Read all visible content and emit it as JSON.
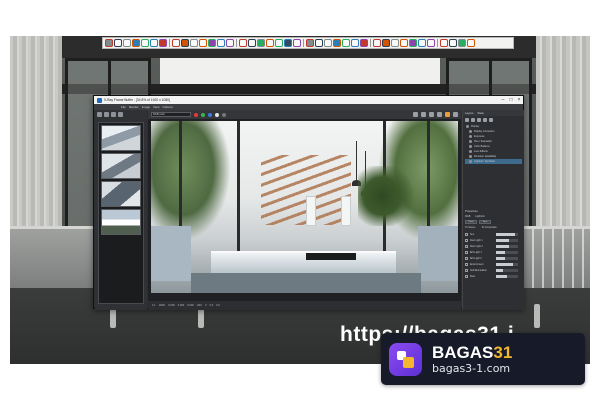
{
  "vfb": {
    "title": "V-Ray Frame Buffer - [34.8% of 1920 x 1080]",
    "menu": [
      "File",
      "Render",
      "Image",
      "View",
      "Options"
    ],
    "layer_select": "RGB color",
    "status": [
      "1:1",
      "100%",
      "0.000",
      "0.000",
      "0.000",
      "HSV",
      "0",
      "0.0",
      "0.0"
    ],
    "panel_tabs": [
      "Layers",
      "Stats"
    ],
    "layers": [
      "Display",
      "Display Correction",
      "Exposure",
      "Hue / Saturation",
      "Color Balance",
      "Lens Effects",
      "Denoiser (available)",
      "Lightmix: Synthetic"
    ],
    "properties_title": "Properties",
    "radio": [
      "RGB",
      "Lightmix"
    ],
    "buttons": [
      "Reset",
      "Save"
    ],
    "check_options": [
      "To Scene",
      "To Composite"
    ],
    "light_rows": [
      {
        "label": "Sun",
        "level": 0.85
      },
      {
        "label": "Rect Light 1",
        "level": 0.6
      },
      {
        "label": "Rect Light 2",
        "level": 0.6
      },
      {
        "label": "IES Light 1",
        "level": 0.4
      },
      {
        "label": "IES Light 2",
        "level": 0.4
      },
      {
        "label": "Environment",
        "level": 0.75
      },
      {
        "label": "Self-illumination",
        "level": 0.3
      },
      {
        "label": "Rest",
        "level": 0.5
      }
    ]
  },
  "watermark": {
    "url_partial": "https://bagas31.i",
    "brand_name_main": "BAGAS",
    "brand_name_accent": "31",
    "brand_site": "bagas3-1.com"
  },
  "colors": {
    "accent_purple": "#7a45e6",
    "accent_yellow": "#f3b72f"
  }
}
